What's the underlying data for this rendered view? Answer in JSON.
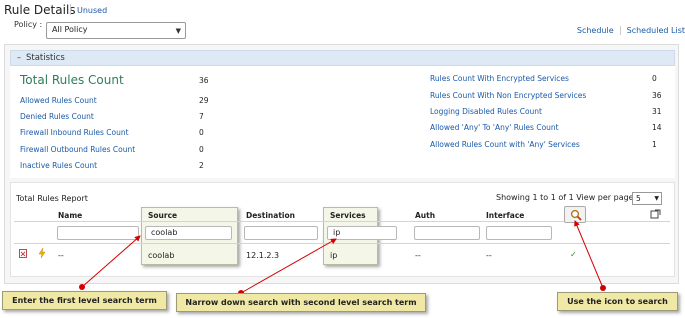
{
  "header": {
    "title": "Rule Details",
    "unused_link": "Unused",
    "policy_label": "Policy :",
    "policy_value": "All Policy",
    "links": [
      "Schedule",
      "Scheduled List"
    ]
  },
  "statistics": {
    "section_title": "Statistics",
    "total_label": "Total Rules Count",
    "total_value": "36",
    "left": [
      {
        "label": "Allowed Rules Count",
        "value": "29"
      },
      {
        "label": "Denied Rules Count",
        "value": "7"
      },
      {
        "label": "Firewall Inbound Rules Count",
        "value": "0"
      },
      {
        "label": "Firewall Outbound Rules Count",
        "value": "0"
      },
      {
        "label": "Inactive Rules Count",
        "value": "2"
      }
    ],
    "right": [
      {
        "label": "Rules Count With Encrypted Services",
        "value": "0"
      },
      {
        "label": "Rules Count With Non Encrypted Services",
        "value": "36"
      },
      {
        "label": "Logging Disabled Rules Count",
        "value": "31"
      },
      {
        "label": "Allowed 'Any' To 'Any' Rules Count",
        "value": "14"
      },
      {
        "label": "Allowed Rules Count with 'Any' Services",
        "value": "1"
      }
    ]
  },
  "report": {
    "title": "Total Rules Report",
    "showing": "Showing 1 to 1 of",
    "total": "1",
    "view_label": "View per page :",
    "per_page": "5",
    "columns": [
      "Name",
      "Source",
      "Destination",
      "Services",
      "Auth",
      "Interface"
    ],
    "filters": {
      "source": "coolab",
      "services": "ip"
    },
    "row": {
      "name": "--",
      "source": "coolab",
      "destination": "12.1.2.3",
      "services": "ip",
      "auth": "--",
      "interface": "--",
      "status": "✓"
    }
  },
  "callouts": {
    "first": "Enter the first level search term",
    "second": "Narrow down search with second level search term",
    "icon": "Use the icon to search"
  },
  "colors": {
    "link": "#1a5aa8",
    "total_green": "#2e7d5b",
    "callout_bg": "#f0e9a6",
    "arrow_red": "#d40000",
    "stats_header_bg": "#dde9f4"
  },
  "icons": [
    "collapse-icon",
    "delete-icon",
    "lightning-icon",
    "search-icon",
    "export-icon",
    "check-icon",
    "dropdown-arrow-icon"
  ]
}
